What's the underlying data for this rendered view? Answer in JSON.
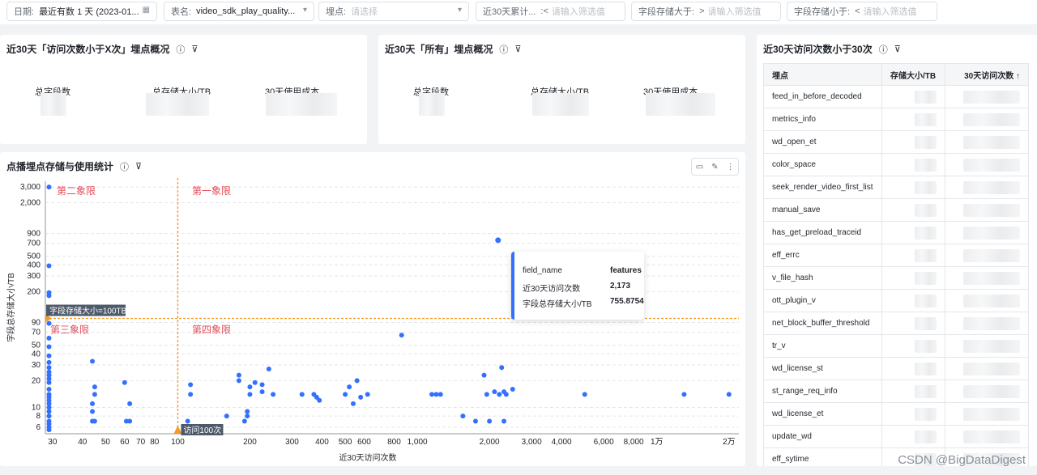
{
  "filters": [
    {
      "label": "日期:",
      "value": "最近有数 1 天 (2023-01...",
      "icon": "calendar-icon"
    },
    {
      "label": "表名:",
      "value": "video_sdk_play_quality...",
      "icon": "chevron-down-icon"
    },
    {
      "label": "埋点:",
      "placeholder": "请选择",
      "icon": "chevron-down-icon"
    },
    {
      "label": "近30天累计...",
      "op": ":<",
      "placeholder": "请输入筛选值"
    },
    {
      "label": "字段存储大于:",
      "op": ">",
      "placeholder": "请输入筛选值"
    },
    {
      "label": "字段存储小于:",
      "op": "<",
      "placeholder": "请输入筛选值"
    }
  ],
  "card1": {
    "title": "近30天「访问次数小于X次」埋点概况",
    "metrics": [
      "总字段数",
      "总存储大小/TB",
      "30天使用成本"
    ]
  },
  "card2": {
    "title": "近30天「所有」埋点概况",
    "metrics": [
      "总字段数",
      "总存储大小/TB",
      "30天使用成本"
    ]
  },
  "table_card": {
    "title": "近30天访问次数小于30次",
    "columns": [
      "埋点",
      "存储大小/TB",
      "30天访问次数 ↑"
    ],
    "rows": [
      "feed_in_before_decoded",
      "metrics_info",
      "wd_open_et",
      "color_space",
      "seek_render_video_first_list",
      "manual_save",
      "has_get_preload_traceid",
      "eff_errc",
      "v_file_hash",
      "ott_plugin_v",
      "net_block_buffer_threshold",
      "tr_v",
      "wd_license_st",
      "st_range_req_info",
      "wd_license_et",
      "update_wd",
      "eff_sytime"
    ]
  },
  "chart_card": {
    "title": "点播埋点存储与使用统计",
    "quadrants": [
      "第二象限",
      "第一象限",
      "第三象限",
      "第四象限"
    ],
    "h_ref_label": "字段存储大小=100TB",
    "v_ref_label": "访问100次",
    "tooltip": {
      "rows": [
        [
          "field_name",
          "features"
        ],
        [
          "近30天访问次数",
          "2,173"
        ],
        [
          "字段总存储大小/TB",
          "755.8754"
        ]
      ]
    }
  },
  "chart_data": {
    "type": "scatter",
    "xlabel": "近30天访问次数",
    "ylabel": "字段总存储大小/TB",
    "xscale": "log",
    "yscale": "log",
    "xlim": [
      28,
      22000
    ],
    "ylim": [
      5.5,
      3200
    ],
    "xticks": [
      {
        "v": 30,
        "t": "30"
      },
      {
        "v": 40,
        "t": "40"
      },
      {
        "v": 50,
        "t": "50"
      },
      {
        "v": 60,
        "t": "60"
      },
      {
        "v": 70,
        "t": "70"
      },
      {
        "v": 80,
        "t": "80"
      },
      {
        "v": 100,
        "t": "100"
      },
      {
        "v": 200,
        "t": "200"
      },
      {
        "v": 300,
        "t": "300"
      },
      {
        "v": 400,
        "t": "400"
      },
      {
        "v": 500,
        "t": "500"
      },
      {
        "v": 600,
        "t": "600"
      },
      {
        "v": 800,
        "t": "800"
      },
      {
        "v": 1000,
        "t": "1,000"
      },
      {
        "v": 2000,
        "t": "2,000"
      },
      {
        "v": 3000,
        "t": "3,000"
      },
      {
        "v": 4000,
        "t": "4,000"
      },
      {
        "v": 6000,
        "t": "6,000"
      },
      {
        "v": 8000,
        "t": "8,000"
      },
      {
        "v": 10000,
        "t": "1万"
      },
      {
        "v": 20000,
        "t": "2万"
      }
    ],
    "yticks": [
      {
        "v": 6,
        "t": "6"
      },
      {
        "v": 8,
        "t": "8"
      },
      {
        "v": 10,
        "t": "10"
      },
      {
        "v": 20,
        "t": "20"
      },
      {
        "v": 30,
        "t": "30"
      },
      {
        "v": 40,
        "t": "40"
      },
      {
        "v": 50,
        "t": "50"
      },
      {
        "v": 70,
        "t": "70"
      },
      {
        "v": 90,
        "t": "90"
      },
      {
        "v": 200,
        "t": "200"
      },
      {
        "v": 300,
        "t": "300"
      },
      {
        "v": 400,
        "t": "400"
      },
      {
        "v": 500,
        "t": "500"
      },
      {
        "v": 700,
        "t": "700"
      },
      {
        "v": 900,
        "t": "900"
      },
      {
        "v": 2000,
        "t": "2,000"
      },
      {
        "v": 3000,
        "t": "3,000"
      }
    ],
    "ref_x": 100,
    "ref_y": 100,
    "points": [
      [
        29,
        3000
      ],
      [
        29,
        390
      ],
      [
        29,
        195
      ],
      [
        29,
        180
      ],
      [
        29,
        88
      ],
      [
        29,
        60
      ],
      [
        29,
        48
      ],
      [
        29,
        38
      ],
      [
        29,
        32
      ],
      [
        29,
        28
      ],
      [
        29,
        25
      ],
      [
        29,
        23
      ],
      [
        29,
        21
      ],
      [
        29,
        19
      ],
      [
        29,
        16
      ],
      [
        29,
        14
      ],
      [
        29,
        13
      ],
      [
        29,
        12
      ],
      [
        29,
        11
      ],
      [
        29,
        10
      ],
      [
        29,
        9
      ],
      [
        29,
        8
      ],
      [
        29,
        7
      ],
      [
        29,
        6.5
      ],
      [
        29,
        6
      ],
      [
        29,
        5.6
      ],
      [
        44,
        33
      ],
      [
        45,
        17
      ],
      [
        45,
        14
      ],
      [
        44,
        11
      ],
      [
        44,
        9
      ],
      [
        44,
        7
      ],
      [
        45,
        7
      ],
      [
        60,
        19
      ],
      [
        61,
        7
      ],
      [
        63,
        7
      ],
      [
        63,
        11
      ],
      [
        110,
        7
      ],
      [
        113,
        18
      ],
      [
        113,
        14
      ],
      [
        160,
        8
      ],
      [
        180,
        23
      ],
      [
        180,
        20
      ],
      [
        190,
        7
      ],
      [
        195,
        8
      ],
      [
        195,
        9
      ],
      [
        200,
        14
      ],
      [
        200,
        17
      ],
      [
        210,
        19
      ],
      [
        225,
        15
      ],
      [
        225,
        18
      ],
      [
        240,
        27
      ],
      [
        250,
        14
      ],
      [
        330,
        14
      ],
      [
        370,
        14
      ],
      [
        380,
        13
      ],
      [
        390,
        12
      ],
      [
        500,
        14
      ],
      [
        520,
        17
      ],
      [
        540,
        11
      ],
      [
        560,
        20
      ],
      [
        580,
        13
      ],
      [
        620,
        14
      ],
      [
        860,
        65
      ],
      [
        1150,
        14
      ],
      [
        1200,
        14
      ],
      [
        1250,
        14
      ],
      [
        1550,
        8
      ],
      [
        1750,
        7
      ],
      [
        1900,
        23
      ],
      [
        1950,
        14
      ],
      [
        2000,
        7
      ],
      [
        2100,
        15
      ],
      [
        2173,
        756
      ],
      [
        2200,
        14
      ],
      [
        2250,
        28
      ],
      [
        2300,
        7
      ],
      [
        2300,
        15
      ],
      [
        2350,
        14
      ],
      [
        2500,
        16
      ],
      [
        5000,
        14
      ],
      [
        13000,
        14
      ],
      [
        20000,
        14
      ]
    ]
  }
}
